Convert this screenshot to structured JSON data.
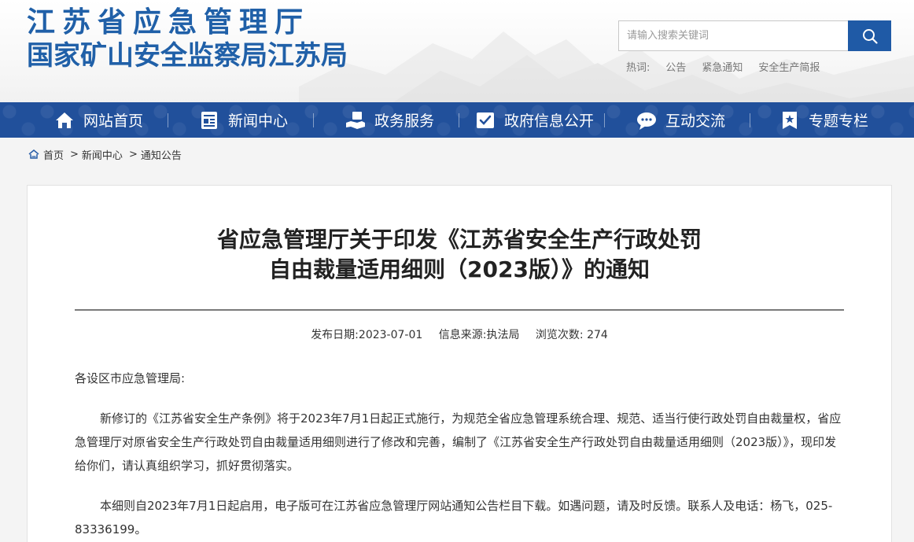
{
  "header": {
    "logo_line1": "江苏省应急管理厅",
    "logo_line2": "国家矿山安全监察局江苏局",
    "search_placeholder": "请输入搜索关键词",
    "hotwords_label": "热词:",
    "hotwords": [
      "公告",
      "紧急通知",
      "安全生产简报"
    ]
  },
  "nav": {
    "items": [
      {
        "label": "网站首页",
        "icon": "home-icon"
      },
      {
        "label": "新闻中心",
        "icon": "newspaper-icon"
      },
      {
        "label": "政务服务",
        "icon": "service-hand-icon"
      },
      {
        "label": "政府信息公开",
        "icon": "check-document-icon"
      },
      {
        "label": "互动交流",
        "icon": "chat-bubble-icon"
      },
      {
        "label": "专题专栏",
        "icon": "bookmark-star-icon"
      }
    ]
  },
  "breadcrumb": {
    "home": "首页",
    "items": [
      "新闻中心",
      "通知公告"
    ],
    "separator": ">"
  },
  "article": {
    "title_line1": "省应急管理厅关于印发《江苏省安全生产行政处罚",
    "title_line2": "自由裁量适用细则（2023版）》的通知",
    "publish_date_label": "发布日期:",
    "publish_date": "2023-07-01",
    "source_label": "信息来源:",
    "source": "执法局",
    "views_label": "浏览次数:",
    "views": "274",
    "salutation": "各设区市应急管理局:",
    "paragraphs": [
      "新修订的《江苏省安全生产条例》将于2023年7月1日起正式施行，为规范全省应急管理系统合理、规范、适当行使行政处罚自由裁量权，省应急管理厅对原省安全生产行政处罚自由裁量适用细则进行了修改和完善，编制了《江苏省安全生产行政处罚自由裁量适用细则（2023版）》，现印发给你们，请认真组织学习，抓好贯彻落实。",
      "本细则自2023年7月1日起启用，电子版可在江苏省应急管理厅网站通知公告栏目下载。如遇问题，请及时反馈。联系人及电话：杨飞，025-83336199。"
    ]
  },
  "colors": {
    "brand_blue": "#2060a8",
    "nav_blue": "#21509b",
    "search_button": "#1f5aa6"
  }
}
